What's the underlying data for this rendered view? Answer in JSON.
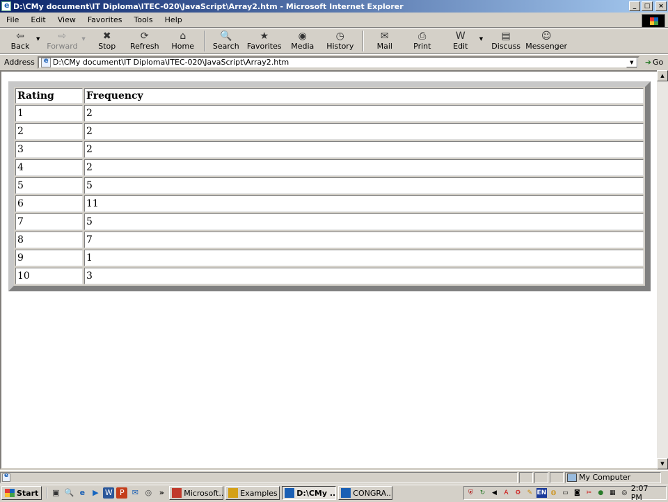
{
  "window": {
    "title": "D:\\CMy document\\IT Diploma\\ITEC-020\\JavaScript\\Array2.htm - Microsoft Internet Explorer",
    "buttons": {
      "minimize": "_",
      "maximize": "□",
      "close": "×"
    }
  },
  "menu": [
    "File",
    "Edit",
    "View",
    "Favorites",
    "Tools",
    "Help"
  ],
  "toolbar": [
    {
      "label": "Back",
      "icon": "back-arrow-icon",
      "glyph": "⇦",
      "enabled": true
    },
    {
      "label": "Forward",
      "icon": "forward-arrow-icon",
      "glyph": "⇨",
      "enabled": false
    },
    {
      "label": "Stop",
      "icon": "stop-icon",
      "glyph": "✖"
    },
    {
      "label": "Refresh",
      "icon": "refresh-icon",
      "glyph": "⟳"
    },
    {
      "label": "Home",
      "icon": "home-icon",
      "glyph": "⌂"
    },
    {
      "label": "Search",
      "icon": "search-icon",
      "glyph": "🔍"
    },
    {
      "label": "Favorites",
      "icon": "favorites-icon",
      "glyph": "★"
    },
    {
      "label": "Media",
      "icon": "media-icon",
      "glyph": "◉"
    },
    {
      "label": "History",
      "icon": "history-icon",
      "glyph": "◷"
    },
    {
      "label": "Mail",
      "icon": "mail-icon",
      "glyph": "✉"
    },
    {
      "label": "Print",
      "icon": "print-icon",
      "glyph": "⎙"
    },
    {
      "label": "Edit",
      "icon": "edit-icon",
      "glyph": "W"
    },
    {
      "label": "Discuss",
      "icon": "discuss-icon",
      "glyph": "▤"
    },
    {
      "label": "Messenger",
      "icon": "messenger-icon",
      "glyph": "☺"
    }
  ],
  "address": {
    "label": "Address",
    "value": "D:\\CMy document\\IT Diploma\\ITEC-020\\JavaScript\\Array2.htm",
    "go_label": "Go"
  },
  "table": {
    "headers": [
      "Rating",
      "Frequency"
    ],
    "rows": [
      [
        "1",
        "2"
      ],
      [
        "2",
        "2"
      ],
      [
        "3",
        "2"
      ],
      [
        "4",
        "2"
      ],
      [
        "5",
        "5"
      ],
      [
        "6",
        "11"
      ],
      [
        "7",
        "5"
      ],
      [
        "8",
        "7"
      ],
      [
        "9",
        "1"
      ],
      [
        "10",
        "3"
      ]
    ]
  },
  "status": {
    "zone": "My Computer"
  },
  "taskbar": {
    "start_label": "Start",
    "tasks": [
      {
        "label": "Microsoft...",
        "active": false,
        "color": "#c0392b"
      },
      {
        "label": "Examples",
        "active": false,
        "color": "#d4a017"
      },
      {
        "label": "D:\\CMy ...",
        "active": true,
        "color": "#1a5fb4"
      },
      {
        "label": "CONGRA...",
        "active": false,
        "color": "#1a5fb4"
      }
    ],
    "clock": "2:07 PM",
    "tray_lang": "EN"
  }
}
